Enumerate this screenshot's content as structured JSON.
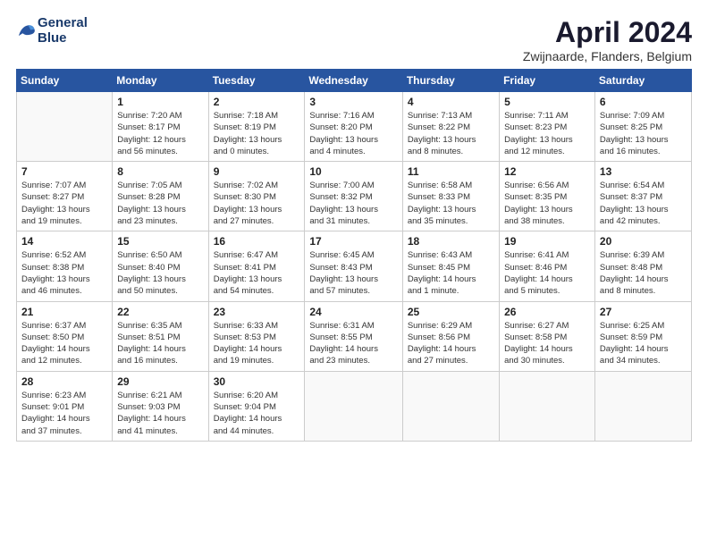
{
  "header": {
    "logo_line1": "General",
    "logo_line2": "Blue",
    "month": "April 2024",
    "location": "Zwijnaarde, Flanders, Belgium"
  },
  "days_of_week": [
    "Sunday",
    "Monday",
    "Tuesday",
    "Wednesday",
    "Thursday",
    "Friday",
    "Saturday"
  ],
  "weeks": [
    [
      {
        "day": "",
        "info": ""
      },
      {
        "day": "1",
        "info": "Sunrise: 7:20 AM\nSunset: 8:17 PM\nDaylight: 12 hours\nand 56 minutes."
      },
      {
        "day": "2",
        "info": "Sunrise: 7:18 AM\nSunset: 8:19 PM\nDaylight: 13 hours\nand 0 minutes."
      },
      {
        "day": "3",
        "info": "Sunrise: 7:16 AM\nSunset: 8:20 PM\nDaylight: 13 hours\nand 4 minutes."
      },
      {
        "day": "4",
        "info": "Sunrise: 7:13 AM\nSunset: 8:22 PM\nDaylight: 13 hours\nand 8 minutes."
      },
      {
        "day": "5",
        "info": "Sunrise: 7:11 AM\nSunset: 8:23 PM\nDaylight: 13 hours\nand 12 minutes."
      },
      {
        "day": "6",
        "info": "Sunrise: 7:09 AM\nSunset: 8:25 PM\nDaylight: 13 hours\nand 16 minutes."
      }
    ],
    [
      {
        "day": "7",
        "info": "Sunrise: 7:07 AM\nSunset: 8:27 PM\nDaylight: 13 hours\nand 19 minutes."
      },
      {
        "day": "8",
        "info": "Sunrise: 7:05 AM\nSunset: 8:28 PM\nDaylight: 13 hours\nand 23 minutes."
      },
      {
        "day": "9",
        "info": "Sunrise: 7:02 AM\nSunset: 8:30 PM\nDaylight: 13 hours\nand 27 minutes."
      },
      {
        "day": "10",
        "info": "Sunrise: 7:00 AM\nSunset: 8:32 PM\nDaylight: 13 hours\nand 31 minutes."
      },
      {
        "day": "11",
        "info": "Sunrise: 6:58 AM\nSunset: 8:33 PM\nDaylight: 13 hours\nand 35 minutes."
      },
      {
        "day": "12",
        "info": "Sunrise: 6:56 AM\nSunset: 8:35 PM\nDaylight: 13 hours\nand 38 minutes."
      },
      {
        "day": "13",
        "info": "Sunrise: 6:54 AM\nSunset: 8:37 PM\nDaylight: 13 hours\nand 42 minutes."
      }
    ],
    [
      {
        "day": "14",
        "info": "Sunrise: 6:52 AM\nSunset: 8:38 PM\nDaylight: 13 hours\nand 46 minutes."
      },
      {
        "day": "15",
        "info": "Sunrise: 6:50 AM\nSunset: 8:40 PM\nDaylight: 13 hours\nand 50 minutes."
      },
      {
        "day": "16",
        "info": "Sunrise: 6:47 AM\nSunset: 8:41 PM\nDaylight: 13 hours\nand 54 minutes."
      },
      {
        "day": "17",
        "info": "Sunrise: 6:45 AM\nSunset: 8:43 PM\nDaylight: 13 hours\nand 57 minutes."
      },
      {
        "day": "18",
        "info": "Sunrise: 6:43 AM\nSunset: 8:45 PM\nDaylight: 14 hours\nand 1 minute."
      },
      {
        "day": "19",
        "info": "Sunrise: 6:41 AM\nSunset: 8:46 PM\nDaylight: 14 hours\nand 5 minutes."
      },
      {
        "day": "20",
        "info": "Sunrise: 6:39 AM\nSunset: 8:48 PM\nDaylight: 14 hours\nand 8 minutes."
      }
    ],
    [
      {
        "day": "21",
        "info": "Sunrise: 6:37 AM\nSunset: 8:50 PM\nDaylight: 14 hours\nand 12 minutes."
      },
      {
        "day": "22",
        "info": "Sunrise: 6:35 AM\nSunset: 8:51 PM\nDaylight: 14 hours\nand 16 minutes."
      },
      {
        "day": "23",
        "info": "Sunrise: 6:33 AM\nSunset: 8:53 PM\nDaylight: 14 hours\nand 19 minutes."
      },
      {
        "day": "24",
        "info": "Sunrise: 6:31 AM\nSunset: 8:55 PM\nDaylight: 14 hours\nand 23 minutes."
      },
      {
        "day": "25",
        "info": "Sunrise: 6:29 AM\nSunset: 8:56 PM\nDaylight: 14 hours\nand 27 minutes."
      },
      {
        "day": "26",
        "info": "Sunrise: 6:27 AM\nSunset: 8:58 PM\nDaylight: 14 hours\nand 30 minutes."
      },
      {
        "day": "27",
        "info": "Sunrise: 6:25 AM\nSunset: 8:59 PM\nDaylight: 14 hours\nand 34 minutes."
      }
    ],
    [
      {
        "day": "28",
        "info": "Sunrise: 6:23 AM\nSunset: 9:01 PM\nDaylight: 14 hours\nand 37 minutes."
      },
      {
        "day": "29",
        "info": "Sunrise: 6:21 AM\nSunset: 9:03 PM\nDaylight: 14 hours\nand 41 minutes."
      },
      {
        "day": "30",
        "info": "Sunrise: 6:20 AM\nSunset: 9:04 PM\nDaylight: 14 hours\nand 44 minutes."
      },
      {
        "day": "",
        "info": ""
      },
      {
        "day": "",
        "info": ""
      },
      {
        "day": "",
        "info": ""
      },
      {
        "day": "",
        "info": ""
      }
    ]
  ]
}
